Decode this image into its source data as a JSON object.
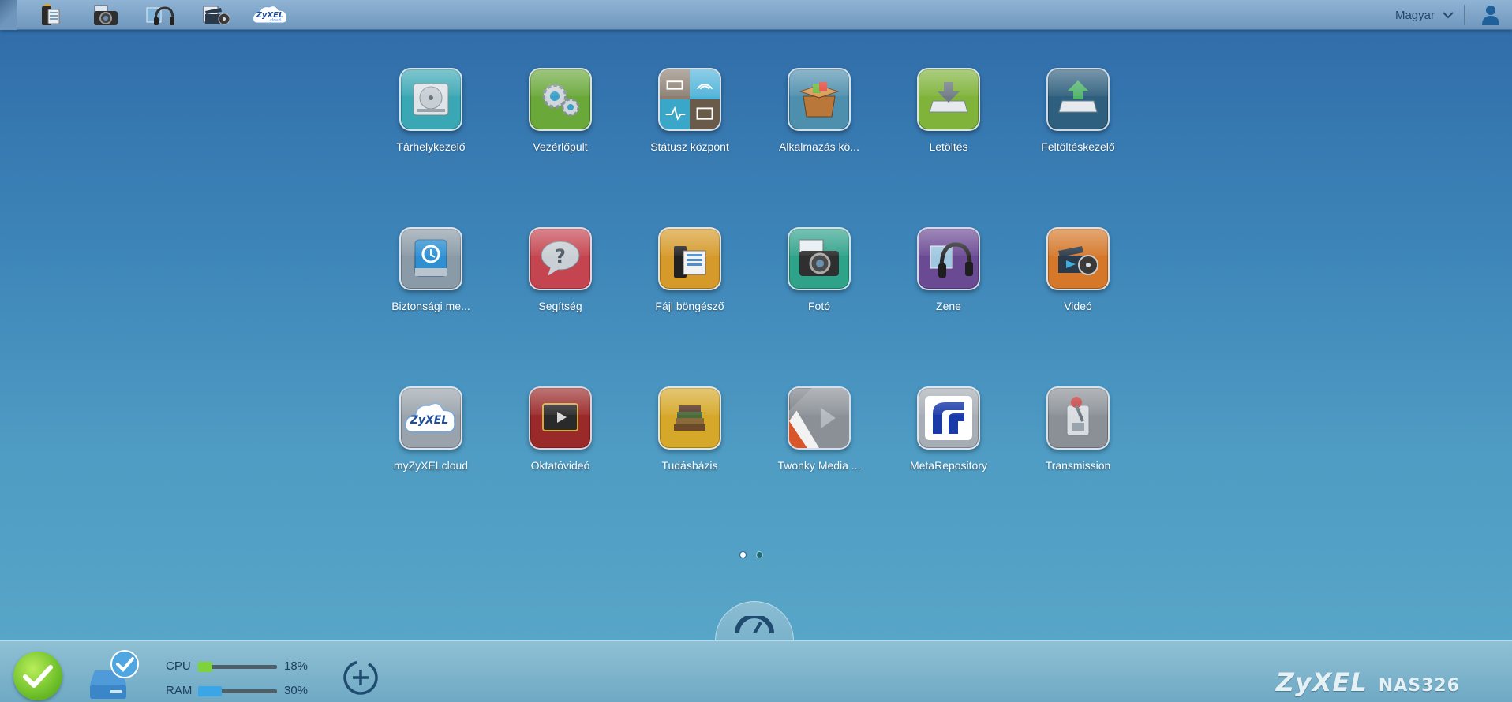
{
  "topbar": {
    "quick_icons": [
      {
        "name": "file-browser-icon"
      },
      {
        "name": "photo-camera-icon"
      },
      {
        "name": "music-headphones-icon"
      },
      {
        "name": "video-clapper-icon"
      },
      {
        "name": "zyxel-cloud-icon",
        "text": "ZyXEL",
        "subtext": "cloud"
      }
    ],
    "language": "Magyar"
  },
  "apps": [
    {
      "label": "Tárhelykezelő",
      "icon": "storage-manager-icon",
      "color": "#3aa7b4"
    },
    {
      "label": "Vezérlőpult",
      "icon": "control-panel-icon",
      "color": "#6aa83a"
    },
    {
      "label": "Státusz központ",
      "icon": "status-center-icon",
      "color": "#7a8a99"
    },
    {
      "label": "Alkalmazás kö...",
      "icon": "app-center-icon",
      "color": "#4f8fae"
    },
    {
      "label": "Letöltés",
      "icon": "download-icon",
      "color": "#7fb33a"
    },
    {
      "label": "Feltöltéskezelő",
      "icon": "upload-manager-icon",
      "color": "#2f5f7e"
    },
    {
      "label": "Biztonsági me...",
      "icon": "backup-icon",
      "color": "#8a9aa6"
    },
    {
      "label": "Segítség",
      "icon": "help-icon",
      "color": "#c4444f"
    },
    {
      "label": "Fájl böngésző",
      "icon": "file-browser-app-icon",
      "color": "#d69a2a"
    },
    {
      "label": "Fotó",
      "icon": "photo-icon",
      "color": "#2fa28a"
    },
    {
      "label": "Zene",
      "icon": "music-icon",
      "color": "#6b4a94"
    },
    {
      "label": "Videó",
      "icon": "video-icon",
      "color": "#d5782a"
    },
    {
      "label": "myZyXELcloud",
      "icon": "myzyxelcloud-icon",
      "color": "#9aa3ab",
      "text": "ZyXEL"
    },
    {
      "label": "Oktatóvideó",
      "icon": "tutorial-video-icon",
      "color": "#9a2a2a"
    },
    {
      "label": "Tudásbázis",
      "icon": "knowledge-base-icon",
      "color": "#d6a82a"
    },
    {
      "label": "Twonky Media ...",
      "icon": "twonky-media-icon",
      "color": "#7a7f85"
    },
    {
      "label": "MetaRepository",
      "icon": "metarepository-icon",
      "color": "#a6adb4"
    },
    {
      "label": "Transmission",
      "icon": "transmission-icon",
      "color": "#8a9096"
    }
  ],
  "pagination": {
    "current": 1,
    "total": 2
  },
  "bottombar": {
    "cpu_label": "CPU",
    "cpu_value": "18%",
    "cpu_fraction": 0.18,
    "cpu_color": "#7ed23a",
    "ram_label": "RAM",
    "ram_value": "30%",
    "ram_fraction": 0.3,
    "ram_color": "#3aa6e8",
    "brand": "ZyXEL",
    "model": "NAS326"
  }
}
